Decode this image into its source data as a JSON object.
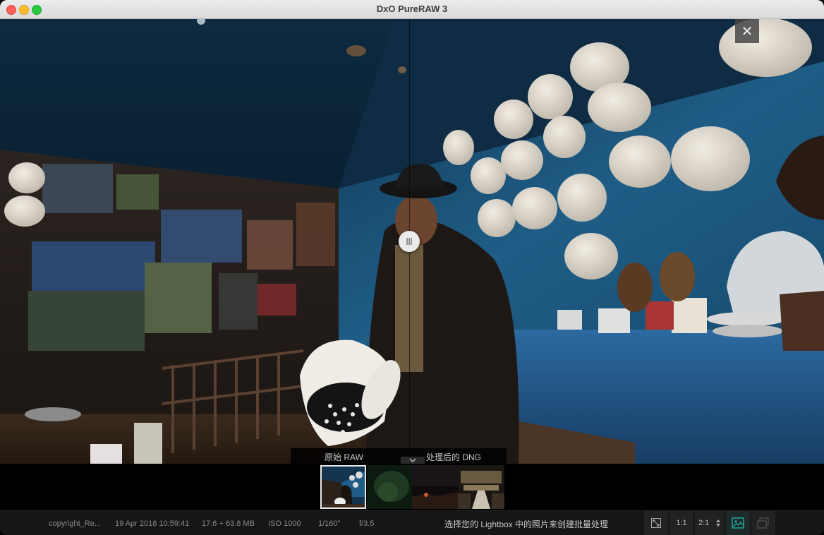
{
  "window": {
    "title": "DxO PureRAW 3"
  },
  "viewer": {
    "close_label": "✕",
    "compare": {
      "left_label": "原始 RAW",
      "right_label": "处理后的 DNG"
    }
  },
  "filmstrip": {
    "selected_index": 0,
    "count": 4
  },
  "status": {
    "filename": "copyright_Re...",
    "datetime": "19 Apr 2018 10:59:41",
    "filesize": "17.6 + 63.8 MB",
    "iso": "ISO 1000",
    "shutter": "1/160\"",
    "aperture": "f/3.5",
    "hint": "选择您的 Lightbox 中的照片来创建批量处理",
    "zoom_1to1": "1:1",
    "zoom_2to1": "2:1"
  },
  "colors": {
    "accent": "#1fb8a8",
    "tarp_blue": "#1f5d86"
  }
}
